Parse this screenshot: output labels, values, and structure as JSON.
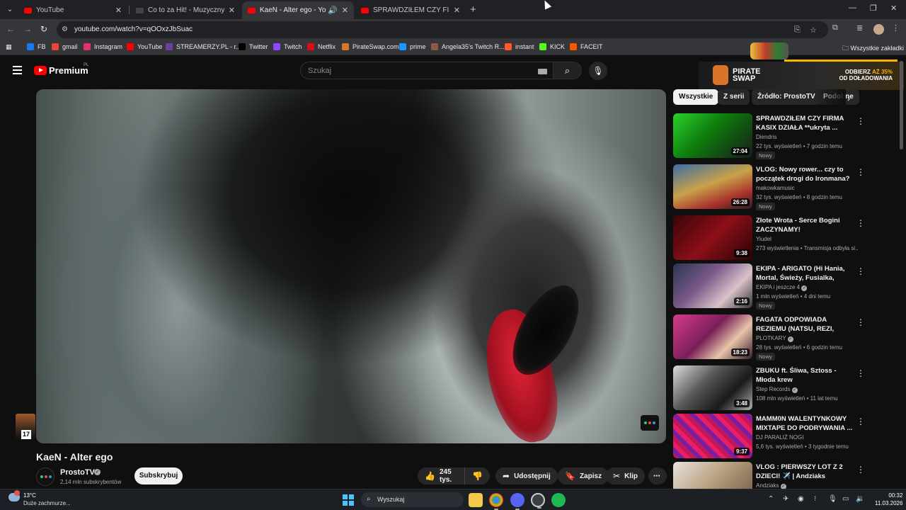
{
  "browser": {
    "tabs": [
      {
        "title": "YouTube"
      },
      {
        "title": "Co to za Hit! - Muzyczny Quiz"
      },
      {
        "title": "KaeN - Alter ego - YouTube"
      },
      {
        "title": "SPRAWDZIŁEM CZY FIRMA KAS"
      }
    ],
    "url": "youtube.com/watch?v=qOOxzJbSuac",
    "bookmarks": [
      {
        "label": "FB",
        "color": "#1877f2"
      },
      {
        "label": "gmail",
        "color": "#ea4335"
      },
      {
        "label": "Instagram",
        "color": "#e1306c"
      },
      {
        "label": "YouTube",
        "color": "#ff0000"
      },
      {
        "label": "STREAMERZY.PL - r...",
        "color": "#6b3fa0"
      },
      {
        "label": "Twitter",
        "color": "#000000"
      },
      {
        "label": "Twitch",
        "color": "#9146ff"
      },
      {
        "label": "Netflix",
        "color": "#e50914"
      },
      {
        "label": "PirateSwap.com",
        "color": "#d9742b"
      },
      {
        "label": "prime",
        "color": "#1a98ff"
      },
      {
        "label": "Angela35's Twitch R...",
        "color": "#8a5a44"
      },
      {
        "label": "instant",
        "color": "#ff5a1f"
      },
      {
        "label": "KICK",
        "color": "#53fc18"
      },
      {
        "label": "FACEIT",
        "color": "#ff5500"
      }
    ],
    "all_bookmarks": "Wszystkie zakładki"
  },
  "youtube": {
    "brand": "Premium",
    "region": "PL",
    "search_placeholder": "Szukaj"
  },
  "ad": {
    "brand_line1": "PIRATE",
    "brand_line2": "SWAP",
    "tag_line1_prefix": "ODBIERZ ",
    "tag_line1_highlight": "AŻ 35%",
    "tag_line2": "OD DOŁADOWANIA"
  },
  "video": {
    "title": "KaeN - Alter ego",
    "channel": "ProstoTV",
    "subscribers": "2,14 mln subskrybentów",
    "subscribe_label": "Subskrybuj",
    "likes": "245 tys.",
    "share_label": "Udostępnij",
    "save_label": "Zapisz",
    "clip_label": "Klip",
    "corner_badge": "17"
  },
  "chips": [
    "Wszystkie",
    "Z serii",
    "Źródło: ProstoTV",
    "Podobne"
  ],
  "recommendations": [
    {
      "title": "SPRAWDZIŁEM CZY FIRMA KASIX DZIAŁA **ukryta ...",
      "channel": "Diendris",
      "meta": "22 tys. wyświetleń • 7 godzin temu",
      "badge": "Nowy",
      "duration": "27:04",
      "thumb_bg": "linear-gradient(135deg,#2bd12b,#0d7a0d 45%,#1a1a1a)",
      "verified": false
    },
    {
      "title": "VLOG: Nowy rower... czy to początek drogi do Ironmana?",
      "channel": "makowkamusic",
      "meta": "32 tys. wyświetleń • 8 godzin temu",
      "badge": "Nowy",
      "duration": "26:28",
      "thumb_bg": "linear-gradient(160deg,#3a6ea5,#c9a14a 45%,#a8322a 75%,#222)",
      "verified": false
    },
    {
      "title": "Złote Wrota - Serce Bogini ZACZYNAMY!",
      "channel": "Yiudel",
      "meta": "273 wyświetlenia • Transmisja odbyła si...",
      "badge": "",
      "duration": "9:38",
      "thumb_bg": "linear-gradient(135deg,#3a0508,#8c0f18 50%,#2a0305)",
      "verified": false
    },
    {
      "title": "EKIPA - ARIGATO (Hi Hania, Mortal, Świeży, Fusialka, Julita...",
      "channel": "EKIPA i jeszcze 4",
      "meta": "1 mln wyświetleń • 4 dni temu",
      "badge": "Nowy",
      "duration": "2:16",
      "thumb_bg": "linear-gradient(135deg,#2a3550,#7a5a8a 40%,#d8c2c8 70%,#333)",
      "verified": true
    },
    {
      "title": "FAGATA ODPOWIADA REZIEMU (NATSU, REZI, RIHANNA, FRIZ,...",
      "channel": "PLOTKARY",
      "meta": "28 tys. wyświetleń • 6 godzin temu",
      "badge": "Nowy",
      "duration": "18:23",
      "thumb_bg": "linear-gradient(135deg,#d63b8a,#7a1f5a 45%,#e7c4a8 70%,#3a1a2a)",
      "verified": true
    },
    {
      "title": "ZBUKU ft. Śliwa, Sztoss - Młoda krew",
      "channel": "Step Records",
      "meta": "108 mln wyświetleń • 11 lat temu",
      "badge": "",
      "duration": "3:48",
      "thumb_bg": "linear-gradient(135deg,#dcdcdc,#555 40%,#1a1a1a 70%,#b0b0b0)",
      "verified": true
    },
    {
      "title": "MAMM0N WALENTYNKOWY MIXTAPE DO PODRYWANIA ...",
      "channel": "DJ PARALIŻ NOGI",
      "meta": "5,6 tys. wyświetleń • 3 tygodnie temu",
      "badge": "",
      "duration": "9:37",
      "thumb_bg": "repeating-linear-gradient(45deg,#c2185b 0 6px,#7b1fa2 6px 12px,#e91e63 12px 18px)",
      "verified": false
    },
    {
      "title": "VLOG : PIERWSZY LOT Z 2 DZIECI! ✈️ | Andziaks",
      "channel": "Andziaks",
      "meta": "",
      "badge": "",
      "duration": "",
      "thumb_bg": "linear-gradient(135deg,#e8e3da,#b59c7d 50%,#6a5440)",
      "verified": true
    }
  ],
  "taskbar": {
    "temperature": "13°C",
    "condition": "Duże zachmurze...",
    "search_placeholder": "Wyszukaj",
    "time": "00:32",
    "date": "11.03.2026"
  }
}
